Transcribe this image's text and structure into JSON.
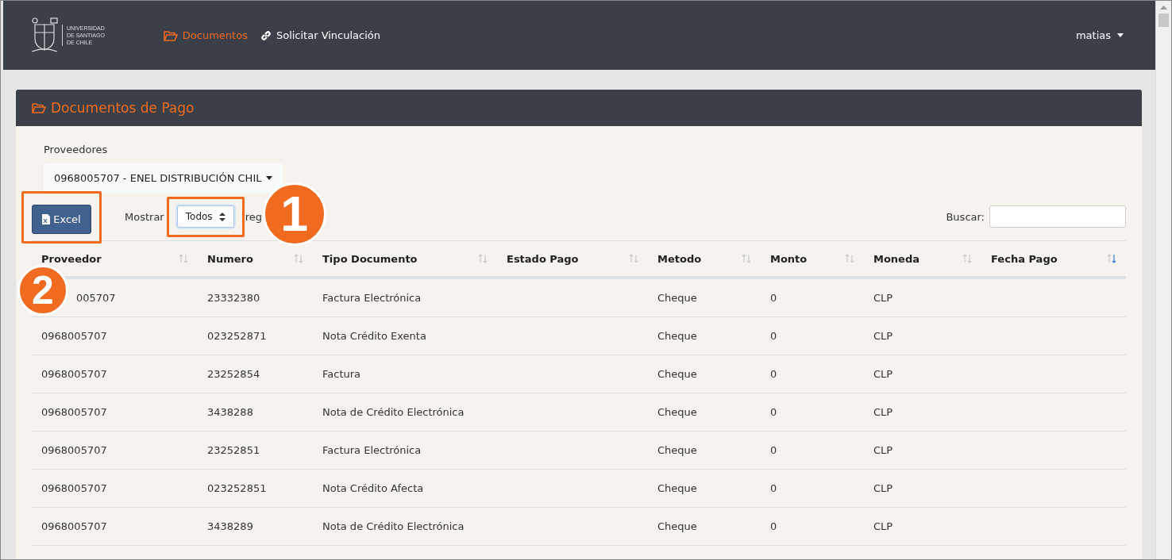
{
  "navbar": {
    "logo_lines": [
      "UNIVERSIDAD",
      "DE SANTIAGO",
      "DE CHILE"
    ],
    "links": [
      {
        "label": "Documentos",
        "selected": true
      },
      {
        "label": "Solicitar Vinculación",
        "selected": false
      }
    ],
    "user": "matias"
  },
  "card": {
    "title": "Documentos de Pago",
    "provider_label": "Proveedores",
    "provider_value": "0968005707 - ENEL DISTRIBUCIÓN CHIL",
    "excel_button": "Excel",
    "show_label": "Mostrar",
    "show_value": "Todos",
    "show_suffix": "reg",
    "search_label": "Buscar:",
    "table": {
      "columns": [
        {
          "label": "Proveedor",
          "sorted_descending": false
        },
        {
          "label": "Numero",
          "sorted_descending": false
        },
        {
          "label": "Tipo Documento",
          "sorted_descending": false
        },
        {
          "label": "Estado Pago",
          "sorted_descending": false
        },
        {
          "label": "Metodo",
          "sorted_descending": false
        },
        {
          "label": "Monto",
          "sorted_descending": false
        },
        {
          "label": "Moneda",
          "sorted_descending": false
        },
        {
          "label": "Fecha Pago",
          "sorted_descending": true
        }
      ],
      "rows": [
        {
          "covered": true,
          "cells": [
            "005707",
            "23332380",
            "Factura Electrónica",
            "",
            "Cheque",
            "0",
            "CLP",
            ""
          ]
        },
        {
          "covered": false,
          "cells": [
            "0968005707",
            "023252871",
            "Nota Crédito Exenta",
            "",
            "Cheque",
            "0",
            "CLP",
            ""
          ]
        },
        {
          "covered": false,
          "cells": [
            "0968005707",
            "23252854",
            "Factura",
            "",
            "Cheque",
            "0",
            "CLP",
            ""
          ]
        },
        {
          "covered": false,
          "cells": [
            "0968005707",
            "3438288",
            "Nota de Crédito Electrónica",
            "",
            "Cheque",
            "0",
            "CLP",
            ""
          ]
        },
        {
          "covered": false,
          "cells": [
            "0968005707",
            "23252851",
            "Factura Electrónica",
            "",
            "Cheque",
            "0",
            "CLP",
            ""
          ]
        },
        {
          "covered": false,
          "cells": [
            "0968005707",
            "023252851",
            "Nota Crédito Afecta",
            "",
            "Cheque",
            "0",
            "CLP",
            ""
          ]
        },
        {
          "covered": false,
          "cells": [
            "0968005707",
            "3438289",
            "Nota de Crédito Electrónica",
            "",
            "Cheque",
            "0",
            "CLP",
            ""
          ]
        }
      ]
    }
  },
  "annotations": [
    {
      "label": "1"
    },
    {
      "label": "2"
    }
  ]
}
